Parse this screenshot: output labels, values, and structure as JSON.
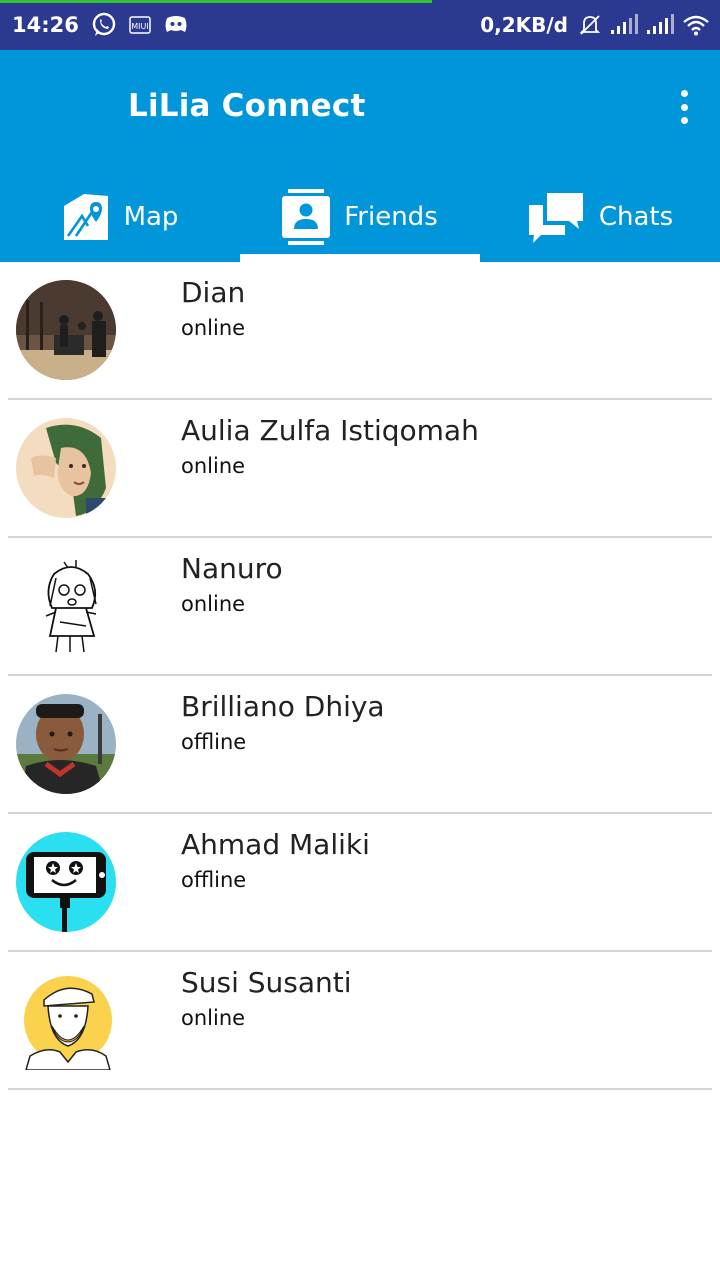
{
  "status_bar": {
    "time": "14:26",
    "net_speed": "0,2KB/d",
    "icons": [
      "whatsapp-icon",
      "miui-icon",
      "discord-icon",
      "mute-bell-icon",
      "signal-1-icon",
      "signal-2-icon",
      "wifi-icon"
    ],
    "download_progress": 0.6
  },
  "app": {
    "title": "LiLia Connect",
    "accent_color": "#0096d9",
    "status_bar_color": "#2b3990"
  },
  "tabs": [
    {
      "label": "Map",
      "icon": "map-icon",
      "selected": false
    },
    {
      "label": "Friends",
      "icon": "contacts-icon",
      "selected": true
    },
    {
      "label": "Chats",
      "icon": "chat-bubbles-icon",
      "selected": false
    }
  ],
  "friends": [
    {
      "name": "Dian",
      "status": "online"
    },
    {
      "name": "Aulia Zulfa Istiqomah",
      "status": "online"
    },
    {
      "name": "Nanuro",
      "status": "online"
    },
    {
      "name": "Brilliano Dhiya",
      "status": "offline"
    },
    {
      "name": "Ahmad Maliki",
      "status": "offline"
    },
    {
      "name": "Susi Susanti",
      "status": "online"
    }
  ]
}
